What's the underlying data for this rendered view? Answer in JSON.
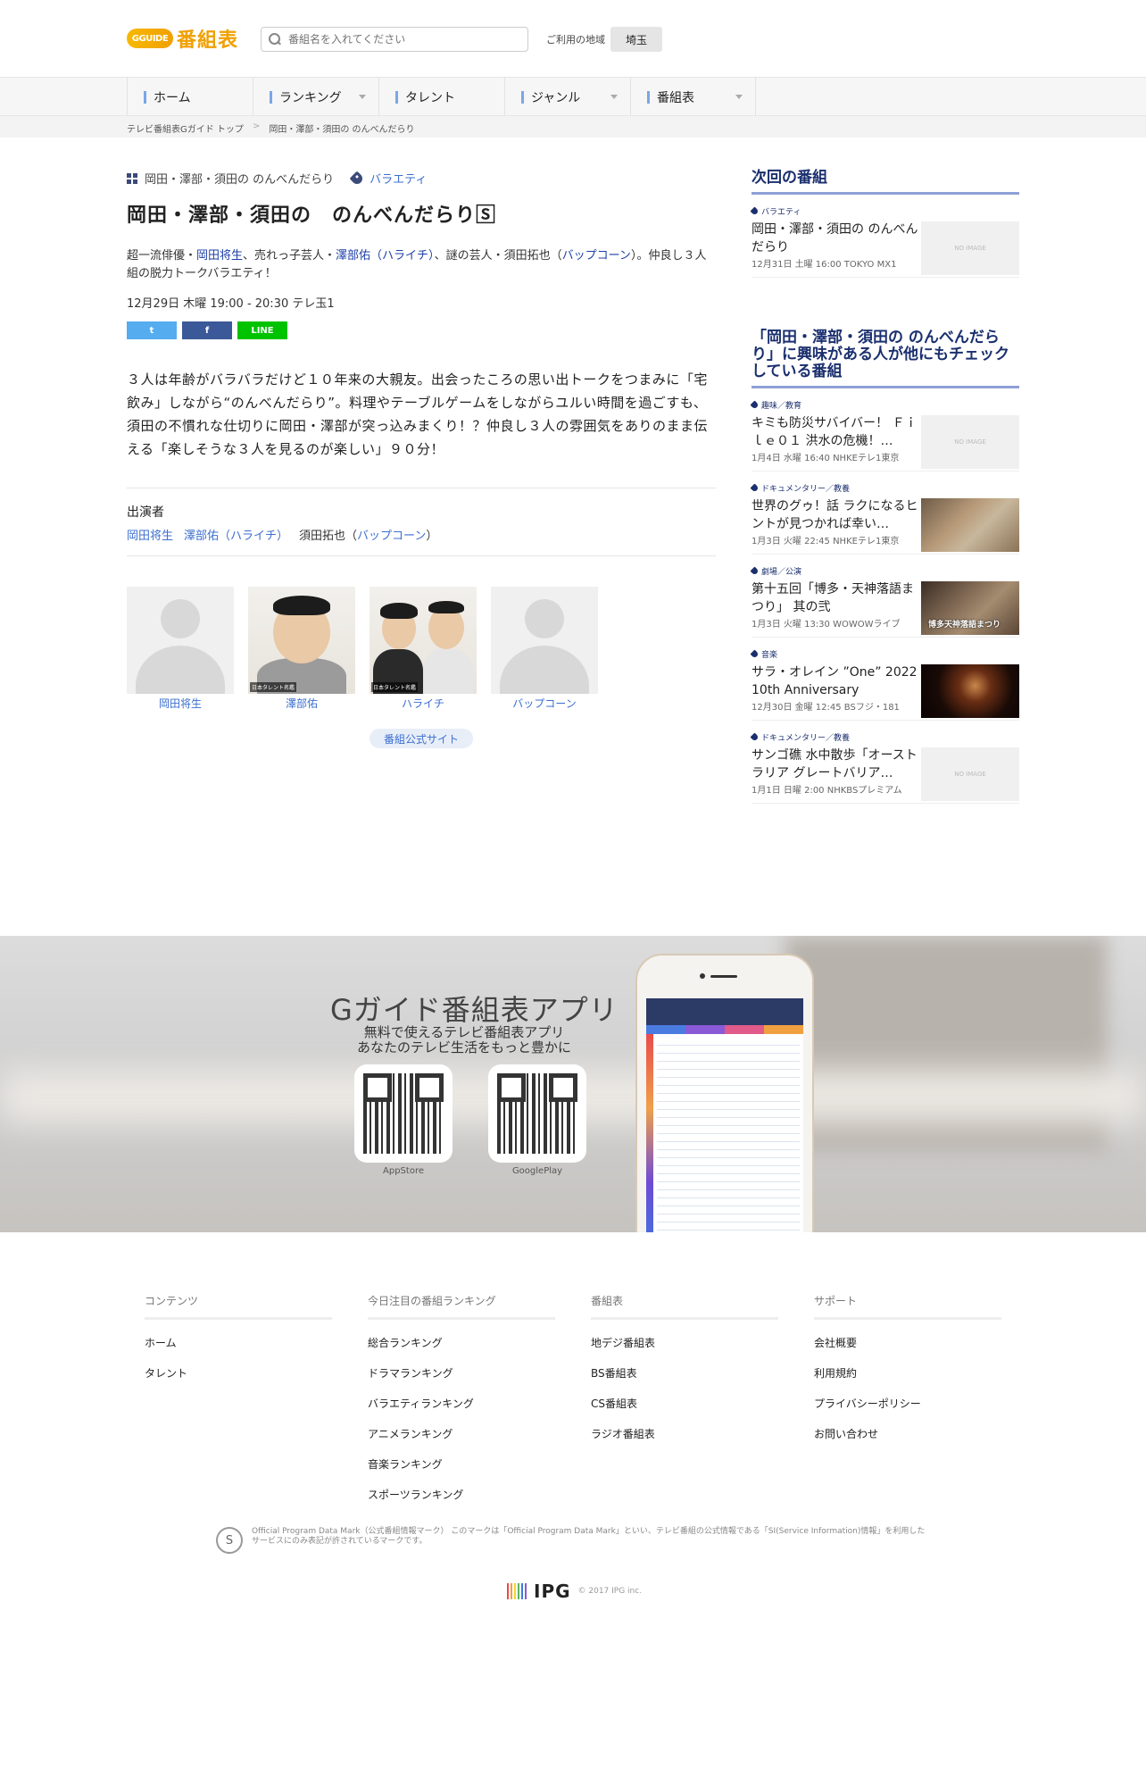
{
  "header": {
    "logo_mark": "GGUIDE",
    "logo_title": "番組表",
    "search_placeholder": "番組名を入れてください",
    "region_label": "ご利用の地域",
    "region_value": "埼玉"
  },
  "nav": [
    {
      "label": "ホーム"
    },
    {
      "label": "ランキング"
    },
    {
      "label": "タレント"
    },
    {
      "label": "ジャンル"
    },
    {
      "label": "番組表"
    }
  ],
  "breadcrumb": [
    "テレビ番組表Gガイド トップ",
    ">",
    "岡田・澤部・須田の のんべんだらり"
  ],
  "program": {
    "series": "岡田・澤部・須田の のんべんだらり",
    "genre": "バラエティ",
    "title": "岡田・澤部・須田の　のんべんだらり🅂",
    "summary_1": "超一流俳優・",
    "summary_link_1": "岡田将生",
    "summary_2": "、売れっ子芸人・",
    "summary_link_2": "澤部佑（ハライチ）",
    "summary_3": "、謎の芸人・須田拓也（",
    "summary_link_3": "バップコーン",
    "summary_4": "）。仲良し３人組の脱力トークバラエティ！",
    "air_info": "12月29日 木曜 19:00 - 20:30 テレ玉1",
    "share_twitter": "t",
    "share_facebook": "f",
    "share_line": "LINE",
    "description": "３人は年齢がバラバラだけど１０年来の大親友。出会ったころの思い出トークをつまみに「宅飲み」しながら“のんべんだらり”。料理やテーブルゲームをしながらユルい時間を過ごすも、須田の不慣れな仕切りに岡田・澤部が突っ込みまくり！？仲良し３人の雰囲気をありのまま伝える「楽しそうな３人を見るのが楽しい」９０分！",
    "cast_heading": "出演者",
    "cast_links": [
      {
        "text": "岡田将生",
        "link": true
      },
      {
        "text": "澤部佑（ハライチ）",
        "link": true
      },
      {
        "text": "須田拓也（",
        "link": false
      },
      {
        "text": "バップコーン",
        "link": true
      },
      {
        "text": "）",
        "link": false
      }
    ],
    "cast_cards": [
      {
        "name": "岡田将生",
        "credit": ""
      },
      {
        "name": "澤部佑",
        "credit": "日本タレント名鑑"
      },
      {
        "name": "ハライチ",
        "credit": "日本タレント名鑑"
      },
      {
        "name": "バップコーン",
        "credit": ""
      }
    ],
    "official_site": "番組公式サイト"
  },
  "sidebar": {
    "next_heading": "次回の番組",
    "next": [
      {
        "genre": "バラエティ",
        "title": "岡田・澤部・須田の のんべんだらり",
        "time": "12月31日 土曜 16:00 TOKYO MX1",
        "thumb": "NO IMAGE"
      }
    ],
    "related_heading": "「岡田・澤部・須田の のんべんだらり」に興味がある人が他にもチェックしている番組",
    "related": [
      {
        "genre": "趣味／教育",
        "title": "キミも防災サバイバー！ Ｆｉｌｅ０１ 洪水の危機！…",
        "time": "1月4日 水曜 16:40 NHKEテレ1東京",
        "thumb": "NO IMAGE"
      },
      {
        "genre": "ドキュメンタリー／教養",
        "title": "世界のグゥ！話 ラクになるヒントが見つかれば幸い…",
        "time": "1月3日 火曜 22:45 NHKEテレ1東京",
        "thumb": ""
      },
      {
        "genre": "劇場／公演",
        "title": "第十五回「博多・天神落語まつり」 其の弐",
        "time": "1月3日 火曜 13:30 WOWOWライブ",
        "thumb": "博多天神落語まつり"
      },
      {
        "genre": "音楽",
        "title": "サラ・オレイン ”One” 2022 10th Anniversary",
        "time": "12月30日 金曜 12:45 BSフジ・181",
        "thumb": ""
      },
      {
        "genre": "ドキュメンタリー／教養",
        "title": "サンゴ礁 水中散歩「オーストラリア グレートバリア…",
        "time": "1月1日 日曜 2:00 NHKBSプレミアム",
        "thumb": "NO IMAGE"
      }
    ]
  },
  "app_banner": {
    "title": "Gガイド番組表アプリ",
    "sub_1": "無料で使えるテレビ番組表アプリ",
    "sub_2": "あなたのテレビ生活をもっと豊かに",
    "appstore_label": "AppStore",
    "googleplay_label": "GooglePlay"
  },
  "footer": {
    "columns": [
      {
        "heading": "コンテンツ",
        "links": [
          "ホーム",
          "タレント"
        ]
      },
      {
        "heading": "今日注目の番組ランキング",
        "links": [
          "総合ランキング",
          "ドラマランキング",
          "バラエティランキング",
          "アニメランキング",
          "音楽ランキング",
          "スポーツランキング"
        ]
      },
      {
        "heading": "番組表",
        "links": [
          "地デジ番組表",
          "BS番組表",
          "CS番組表",
          "ラジオ番組表"
        ]
      },
      {
        "heading": "サポート",
        "links": [
          "会社概要",
          "利用規約",
          "プライバシーポリシー",
          "お問い合わせ"
        ]
      }
    ],
    "mark_letter": "S",
    "note": "Official Program Data Mark（公式番組情報マーク） このマークは「Official Program Data Mark」といい、テレビ番組の公式情報である「SI(Service Information)情報」を利用したサービスにのみ表記が許されているマークです。",
    "ipg_word": "IPG",
    "copyright": "© 2017 IPG inc."
  },
  "colors": {
    "accent": "#3c6fd0",
    "heading_navy": "#1a2f6e",
    "logo_yellow": "#f0a000"
  }
}
